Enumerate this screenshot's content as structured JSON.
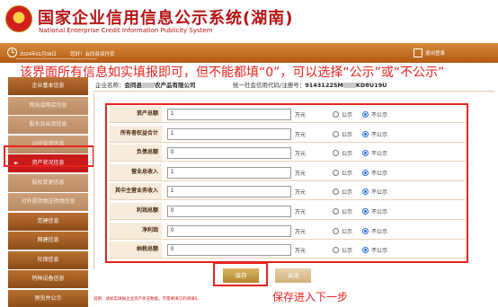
{
  "header": {
    "title": "国家企业信用信息公示系统",
    "province": "(湖南)",
    "subtitle": "National Enterprise Credit Information Publicity System"
  },
  "topbar": {
    "date": "2024年01月08日",
    "user": "您好！会同县双丹农",
    "logout_label": "退出登录"
  },
  "annotations": {
    "top": "该界面所有信息如实填报即可，但不能都填“0”，可以选择“公示”或“不公示”",
    "bottom": "保存进入下一步"
  },
  "sidebar": {
    "items": [
      {
        "label": "企业基本信息",
        "style": "dark"
      },
      {
        "label": "网站或网店信息",
        "style": "light"
      },
      {
        "label": "股东及出资信息",
        "style": "light"
      },
      {
        "label": "对外投资信息",
        "style": "light"
      },
      {
        "label": "资产状况信息",
        "style": "active",
        "arrow": "►"
      },
      {
        "label": "股权变更信息",
        "style": "light"
      },
      {
        "label": "对外提供保证担保信息",
        "style": "light"
      },
      {
        "label": "党建信息",
        "style": "dark"
      },
      {
        "label": "网建信息",
        "style": "dark"
      },
      {
        "label": "社保信息",
        "style": "dark"
      },
      {
        "label": "特种设备信息",
        "style": "dark"
      },
      {
        "label": "预览并公示",
        "style": "dark"
      }
    ]
  },
  "company": {
    "name_label": "企业名称：",
    "name_value_start": "会同县",
    "name_value_end": "农产品有限公司",
    "credit_label": "统一社会信用代码/注册号：",
    "credit_value_start": "91431225M",
    "credit_value_end": "KD8U19U"
  },
  "form": {
    "rows": [
      {
        "label": "资产总额",
        "value": "1",
        "unit": "万元",
        "public": "公示",
        "private": "不公示"
      },
      {
        "label": "所有者权益合计",
        "value": "1",
        "unit": "万元",
        "public": "公示",
        "private": "不公示"
      },
      {
        "label": "负债总额",
        "value": "0",
        "unit": "万元",
        "public": "公示",
        "private": "不公示"
      },
      {
        "label": "营业总收入",
        "value": "1",
        "unit": "万元",
        "public": "公示",
        "private": "不公示"
      },
      {
        "label": "其中主营业务收入",
        "value": "1",
        "unit": "万元",
        "public": "公示",
        "private": "不公示"
      },
      {
        "label": "利润总额",
        "value": "0",
        "unit": "万元",
        "public": "公示",
        "private": "不公示"
      },
      {
        "label": "净利润",
        "value": "0",
        "unit": "万元",
        "public": "公示",
        "private": "不公示"
      },
      {
        "label": "纳税总额",
        "value": "0",
        "unit": "万元",
        "public": "公示",
        "private": "不公示"
      }
    ]
  },
  "buttons": {
    "save": "保存",
    "close": "关闭"
  },
  "note": "说明：请如实填报企业资产状况数据，不需要填写的请填0。"
}
